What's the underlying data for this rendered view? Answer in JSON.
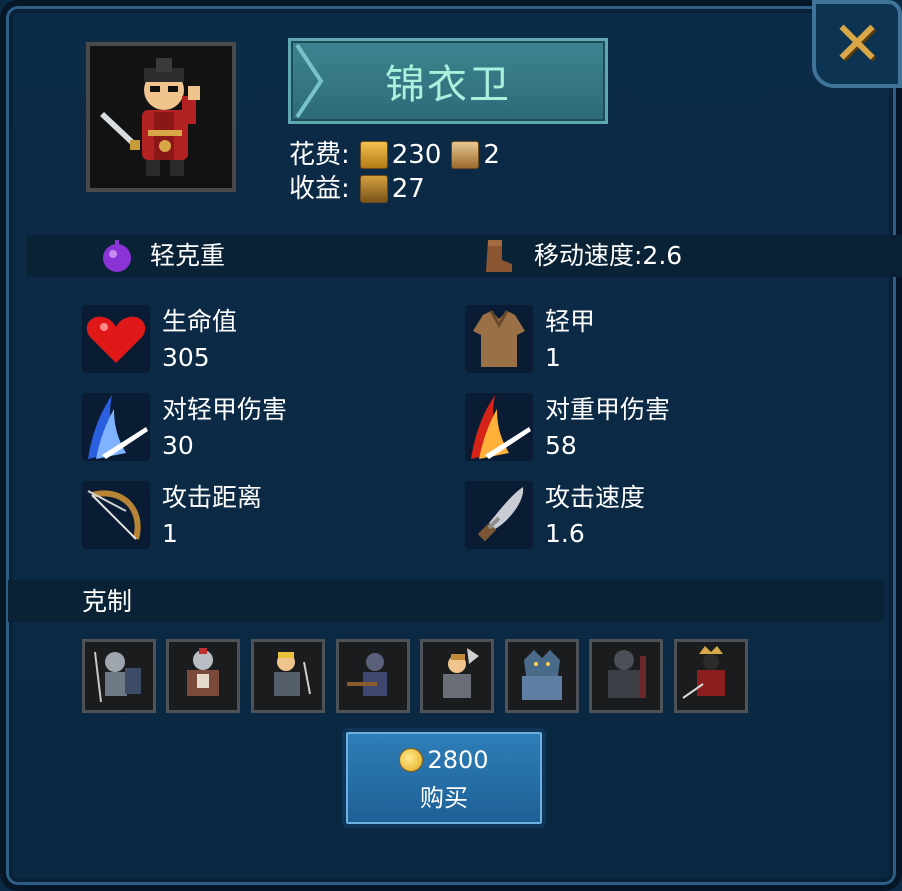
{
  "unit": {
    "name": "锦衣卫"
  },
  "cost": {
    "label": "花费:",
    "gold": "230",
    "population": "2"
  },
  "income": {
    "label": "收益:",
    "value": "27"
  },
  "traits": {
    "class_label": "轻克重",
    "move_speed_label": "移动速度:2.6"
  },
  "stats": [
    {
      "label": "生命值",
      "value": "305",
      "icon": "heart-icon"
    },
    {
      "label": "轻甲",
      "value": "1",
      "icon": "light-armor-icon"
    },
    {
      "label": "对轻甲伤害",
      "value": "30",
      "icon": "blue-slash-icon"
    },
    {
      "label": "对重甲伤害",
      "value": "58",
      "icon": "red-slash-icon"
    },
    {
      "label": "攻击距离",
      "value": "1",
      "icon": "bow-icon"
    },
    {
      "label": "攻击速度",
      "value": "1.6",
      "icon": "dagger-icon"
    }
  ],
  "counter": {
    "title": "克制",
    "count": 8
  },
  "buy": {
    "price": "2800",
    "label": "购买"
  },
  "colors": {
    "accent_gold": "#d7a748",
    "name_text": "#a9f0dd",
    "panel_bg": "#0c2b47",
    "buy_button": "#2f7fb9"
  }
}
